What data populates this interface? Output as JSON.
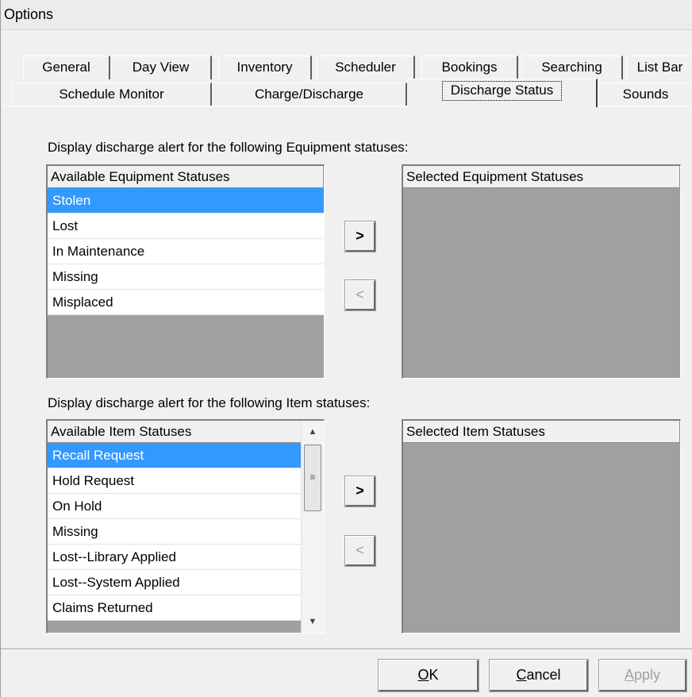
{
  "window": {
    "title": "Options"
  },
  "tabs": {
    "row1": [
      "General",
      "Day View",
      "Inventory",
      "Scheduler",
      "Bookings",
      "Searching",
      "List Bar"
    ],
    "row2": [
      "Schedule Monitor",
      "Charge/Discharge",
      "Discharge Status",
      "Sounds"
    ],
    "active": "Discharge Status"
  },
  "equipment": {
    "caption": "Display discharge alert for the following Equipment statuses:",
    "available_header": "Available Equipment Statuses",
    "available_items": [
      "Stolen",
      "Lost",
      "In Maintenance",
      "Missing",
      "Misplaced"
    ],
    "selected_index": 0,
    "selected_header": "Selected Equipment Statuses",
    "add_label": ">",
    "remove_label": "<"
  },
  "item": {
    "caption": "Display discharge alert for the following Item statuses:",
    "available_header": "Available Item Statuses",
    "available_items": [
      "Recall Request",
      "Hold Request",
      "On Hold",
      "Missing",
      "Lost--Library Applied",
      "Lost--System Applied",
      "Claims Returned"
    ],
    "selected_index": 0,
    "selected_header": "Selected Item Statuses",
    "add_label": ">",
    "remove_label": "<"
  },
  "footer": {
    "ok": {
      "mnemonic": "O",
      "rest": "K"
    },
    "cancel": {
      "mnemonic": "C",
      "rest": "ancel"
    },
    "apply": {
      "mnemonic": "A",
      "rest": "pply"
    }
  },
  "colors": {
    "selection": "#3399ff",
    "list_empty": "#a0a0a0",
    "dialog": "#f0f0f0"
  }
}
